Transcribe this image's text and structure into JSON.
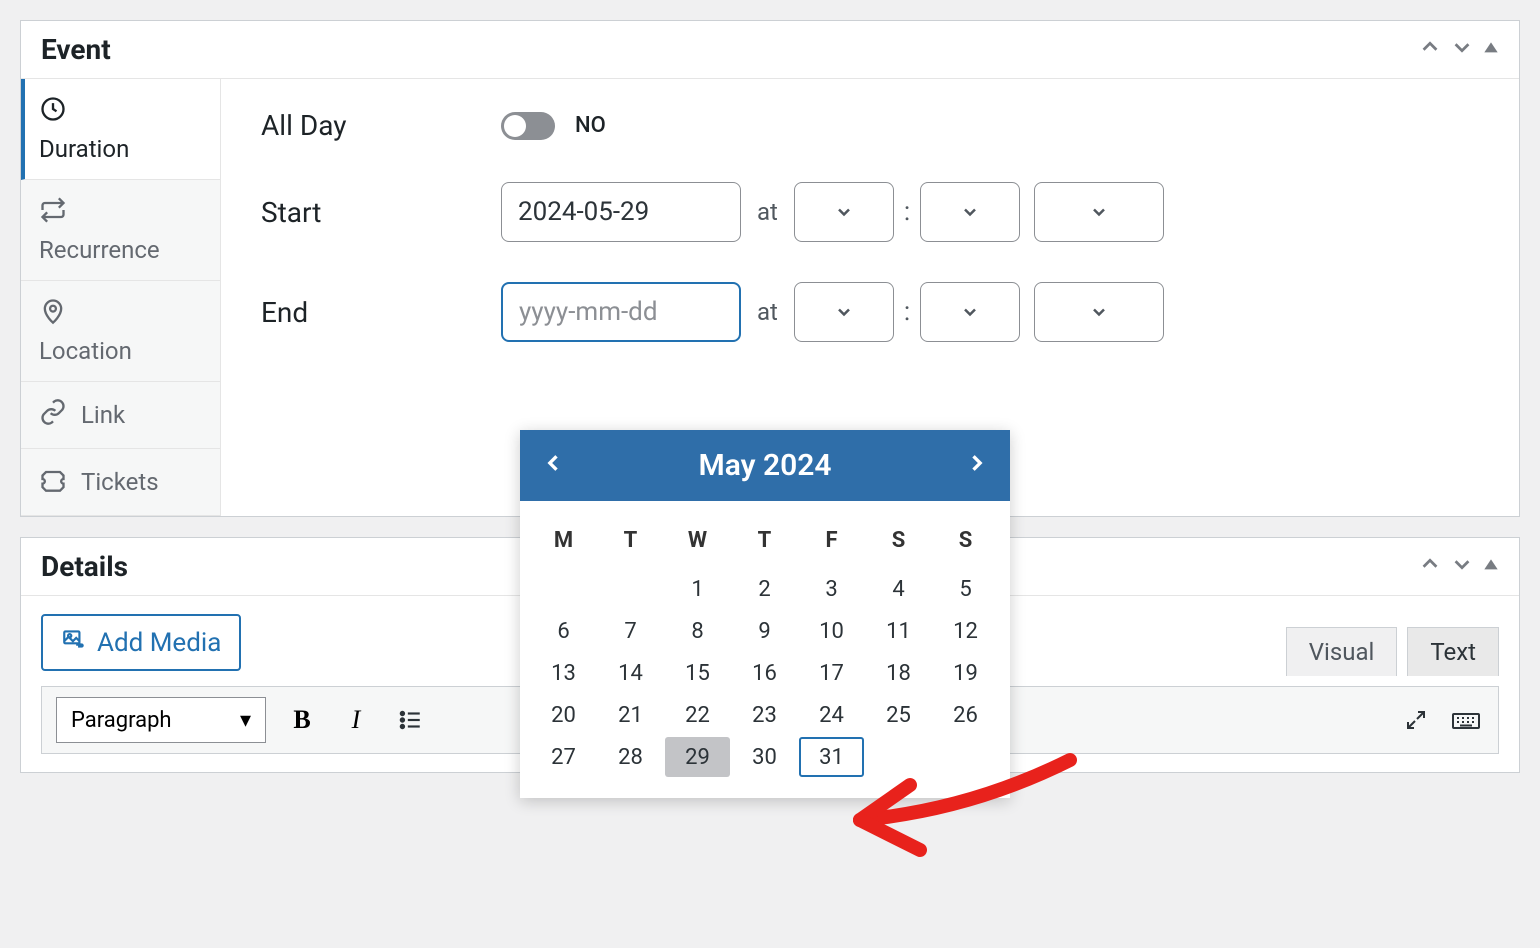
{
  "panels": {
    "event_title": "Event",
    "details_title": "Details"
  },
  "sidebar": {
    "duration": "Duration",
    "recurrence": "Recurrence",
    "location": "Location",
    "link": "Link",
    "tickets": "Tickets"
  },
  "duration": {
    "all_day_label": "All Day",
    "all_day_value": "NO",
    "start_label": "Start",
    "start_date": "2024-05-29",
    "end_label": "End",
    "end_placeholder": "yyyy-mm-dd",
    "at": "at",
    "colon": ":"
  },
  "calendar": {
    "title": "May 2024",
    "dow": [
      "M",
      "T",
      "W",
      "T",
      "F",
      "S",
      "S"
    ],
    "weeks": [
      [
        "",
        "",
        "1",
        "2",
        "3",
        "4",
        "5"
      ],
      [
        "6",
        "7",
        "8",
        "9",
        "10",
        "11",
        "12"
      ],
      [
        "13",
        "14",
        "15",
        "16",
        "17",
        "18",
        "19"
      ],
      [
        "20",
        "21",
        "22",
        "23",
        "24",
        "25",
        "26"
      ],
      [
        "27",
        "28",
        "29",
        "30",
        "31",
        "",
        ""
      ]
    ],
    "today": "29",
    "selected": "31"
  },
  "editor": {
    "add_media": "Add Media",
    "visual_tab": "Visual",
    "text_tab": "Text",
    "paragraph": "Paragraph"
  }
}
